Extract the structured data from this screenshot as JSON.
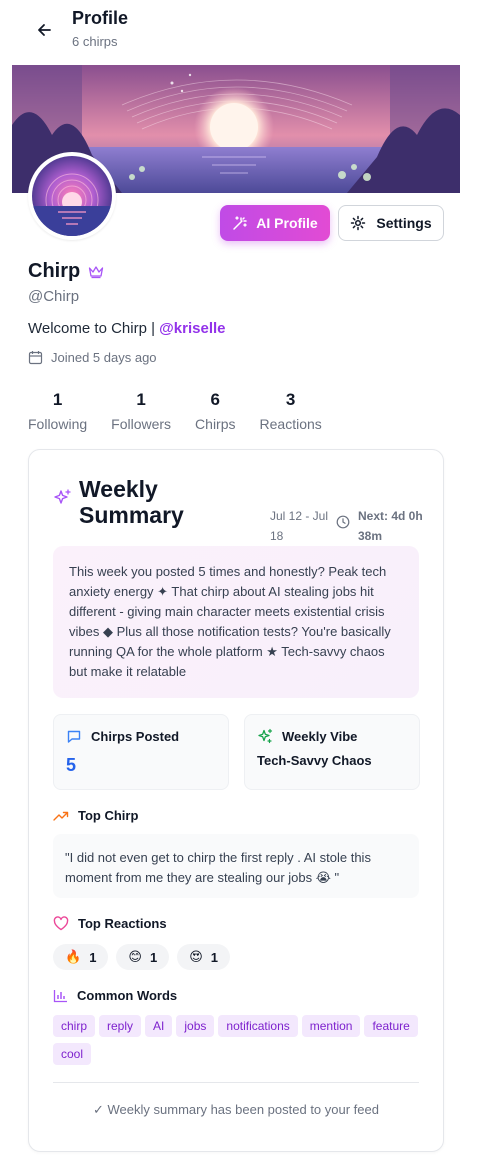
{
  "header": {
    "title": "Profile",
    "subtitle": "6 chirps",
    "back_icon": "arrow-left-icon"
  },
  "profile": {
    "name": "Chirp",
    "handle": "@Chirp",
    "bio_prefix": "Welcome to Chirp | ",
    "bio_mention": "@kriselle",
    "joined": "Joined 5 days ago",
    "crown_icon": "crown-icon",
    "calendar_icon": "calendar-icon"
  },
  "buttons": {
    "ai_profile": "AI Profile",
    "settings": "Settings"
  },
  "stats": [
    {
      "value": "1",
      "label": "Following"
    },
    {
      "value": "1",
      "label": "Followers"
    },
    {
      "value": "6",
      "label": "Chirps"
    },
    {
      "value": "3",
      "label": "Reactions"
    }
  ],
  "summary": {
    "title": "Weekly Summary",
    "date_range": "Jul 12 - Jul 18",
    "next": "Next: 4d 0h 38m",
    "text": "This week you posted 5 times and honestly? Peak tech anxiety energy ✦ That chirp about AI stealing jobs hit different - giving main character meets existential crisis vibes ◆ Plus all those notification tests? You're basically running QA for the whole platform ★ Tech-savvy chaos but make it relatable",
    "chirps_posted_label": "Chirps Posted",
    "chirps_posted_value": "5",
    "weekly_vibe_label": "Weekly Vibe",
    "weekly_vibe_value": "Tech-Savvy Chaos",
    "top_chirp_label": "Top Chirp",
    "top_chirp_text": "\"I did not even get to chirp the first reply . AI stole this moment from me they are stealing our jobs 😭 \"",
    "top_reactions_label": "Top Reactions",
    "reactions": [
      {
        "emoji": "🔥",
        "count": "1"
      },
      {
        "emoji": "😊",
        "count": "1"
      },
      {
        "emoji": "😍",
        "count": "1"
      }
    ],
    "common_words_label": "Common Words",
    "words": [
      "chirp",
      "reply",
      "AI",
      "jobs",
      "notifications",
      "mention",
      "feature",
      "cool"
    ],
    "footer": "✓ Weekly summary has been posted to your feed"
  },
  "colors": {
    "accent_purple": "#9333ea",
    "ai_gradient_start": "#c04be6",
    "ai_gradient_end": "#e24bd4",
    "blue": "#2563eb",
    "green": "#16a34a",
    "orange": "#f97316",
    "pink": "#ec4899"
  }
}
